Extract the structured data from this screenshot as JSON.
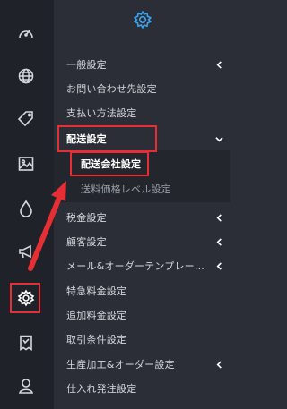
{
  "colors": {
    "rail_bg": "#1f2229",
    "panel_bg": "#2b2e36",
    "submenu_bg": "#23262d",
    "text": "#d5d8dc",
    "accent_blue": "#3aa3f0",
    "highlight_red": "#e52f35"
  },
  "rail": {
    "items": [
      {
        "icon": "speedometer-icon"
      },
      {
        "icon": "globe-icon"
      },
      {
        "icon": "tag-icon"
      },
      {
        "icon": "image-icon"
      },
      {
        "icon": "water-drop-icon"
      },
      {
        "icon": "megaphone-icon"
      },
      {
        "icon": "gear-icon",
        "active": true
      },
      {
        "icon": "receipt-icon"
      },
      {
        "icon": "user-icon"
      }
    ]
  },
  "panel": {
    "header_icon": "gear-icon",
    "menu": [
      {
        "label": "一般設定",
        "chevron": "left"
      },
      {
        "label": "お問い合わせ先設定"
      },
      {
        "label": "支払い方法設定"
      },
      {
        "label": "配送設定",
        "chevron": "down",
        "expanded": true
      },
      {
        "label": "配送会社設定",
        "sub": true,
        "selected": true
      },
      {
        "label": "送料価格レベル設定",
        "sub": true
      },
      {
        "label": "税金設定",
        "chevron": "left"
      },
      {
        "label": "顧客設定",
        "chevron": "left"
      },
      {
        "label": "メール&オーダーテンプレー…",
        "chevron": "left"
      },
      {
        "label": "特急料金設定"
      },
      {
        "label": "追加料金設定"
      },
      {
        "label": "取引条件設定"
      },
      {
        "label": "生産加工&オーダー設定",
        "chevron": "left"
      },
      {
        "label": "仕入れ発注設定"
      }
    ]
  }
}
